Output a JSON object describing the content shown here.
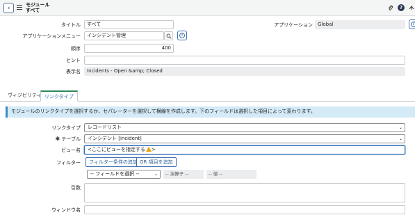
{
  "header": {
    "title": "モジュール",
    "subtitle": "すべて",
    "icons": [
      "back-icon",
      "menu-icon",
      "paperclip-icon",
      "info-icon",
      "more-icon"
    ]
  },
  "form": {
    "title_label": "タイトル",
    "title_value": "すべて",
    "app_menu_label": "アプリケーションメニュー",
    "app_menu_value": "インシデント管理",
    "order_label": "順序",
    "order_value": "400",
    "hint_label": "ヒント",
    "hint_value": "",
    "display_name_label": "表示名",
    "display_name_value": "Incidents - Open &amp; Closed",
    "application_label": "アプリケーション",
    "application_value": "Global"
  },
  "tabs": [
    {
      "label": "ヴィジビリティ",
      "active": false
    },
    {
      "label": "リンクタイプ",
      "active": true
    }
  ],
  "link_section": {
    "banner": "モジュールのリンクタイプを選択するか、セパレーターを選択して横線を作成します。下のフィールドは選択した項目によって変わります。",
    "link_type_label": "リンクタイプ",
    "link_type_value": "レコードリスト",
    "table_label": "テーブル",
    "table_required": "✱",
    "table_value": "インシデント [incident]",
    "view_label": "ビュー名",
    "view_value": "<ここにビューを指定する",
    "view_value_suffix": ">",
    "filter_label": "フィルター",
    "add_condition_btn": "フィルター条件の追加",
    "or_btn": "OR 項目を追加",
    "field_select": "-- フィールドを選択 --",
    "operator_placeholder": "-- 演算子 --",
    "value_placeholder": "-- 値 --",
    "args_label": "引数",
    "window_label": "ウィンドウ名"
  }
}
